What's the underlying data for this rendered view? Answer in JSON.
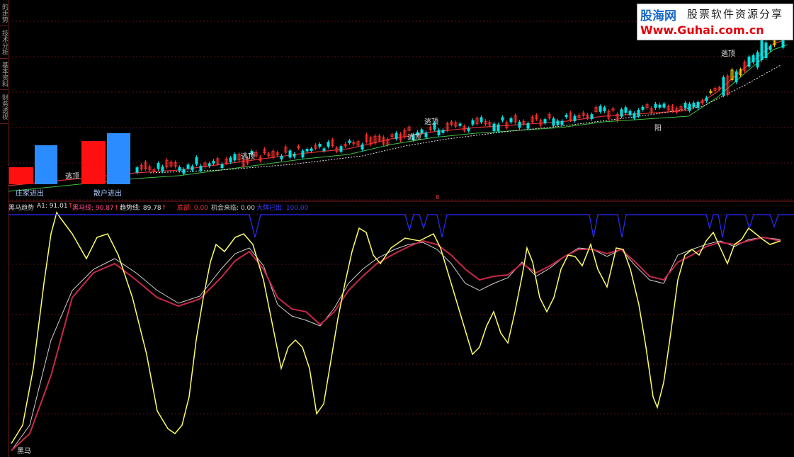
{
  "sidebar": {
    "tabs": [
      {
        "label": "的走势"
      },
      {
        "label": "技术分析"
      },
      {
        "label": "基本资料"
      },
      {
        "label": "财务透视"
      }
    ]
  },
  "logo": {
    "site_name": "股海网",
    "slogan": "股票软件资源分享",
    "url": "Www.Guhai.com.cn"
  },
  "main_chart": {
    "annotations": {
      "escape_top": "逃顶",
      "zhuang_label": "庄家进出",
      "sanhu_label": "散户进出",
      "sun_label": "阳"
    },
    "bottom_marker": "8"
  },
  "indicator": {
    "name": "黑马趋势",
    "a1": "A1: 91.01",
    "heima_line": "黑马线: 90.87",
    "trend_line": "趋势线: 89.78",
    "bottom": "底部: 0.00",
    "opportunity": "机会来临: 0.00",
    "top_sell": "大牌已出: 100.00",
    "corner_label": "黑马",
    "colors": {
      "name": "#d0d0d0",
      "a1": "#e0e0e0",
      "heima_line": "#ff4a8a",
      "trend_line": "#e0e0e0",
      "bottom": "#ff3030",
      "opportunity": "#d0d0d0",
      "top_sell": "#3a3aff",
      "arrow": "#ff4040"
    }
  },
  "colors": {
    "yellow": "#ffff66",
    "red_line": "#c8284a",
    "white_line": "#cfcfcf",
    "blue_line": "#2b2bff",
    "grid": "#5a1212",
    "up_candle": "#ff2d2d",
    "down_candle": "#00e0e0",
    "zhuang_bar": "#ff1010",
    "sanhu_bar": "#2a8cff"
  }
}
